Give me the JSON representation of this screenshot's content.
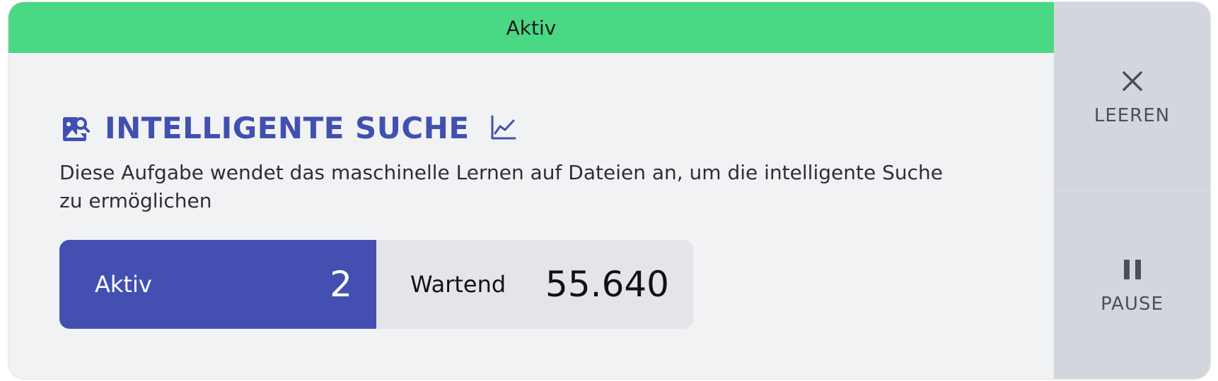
{
  "status": {
    "label": "Aktiv",
    "color": "#4ad885"
  },
  "task": {
    "title": "INTELLIGENTE SUCHE",
    "title_icon": "image-search-icon",
    "chart_icon": "line-chart-icon",
    "description": "Diese Aufgabe wendet das maschinelle Lernen auf Dateien an, um die intelligente Suche zu ermöglichen",
    "accent_color": "#4150b0"
  },
  "counters": {
    "active": {
      "label": "Aktiv",
      "value": "2",
      "color": "#4350b1"
    },
    "waiting": {
      "label": "Wartend",
      "value": "55.640",
      "color": "#e4e5e8"
    }
  },
  "actions": {
    "clear": {
      "label": "LEEREN",
      "icon": "close-icon"
    },
    "pause": {
      "label": "PAUSE",
      "icon": "pause-icon"
    }
  }
}
